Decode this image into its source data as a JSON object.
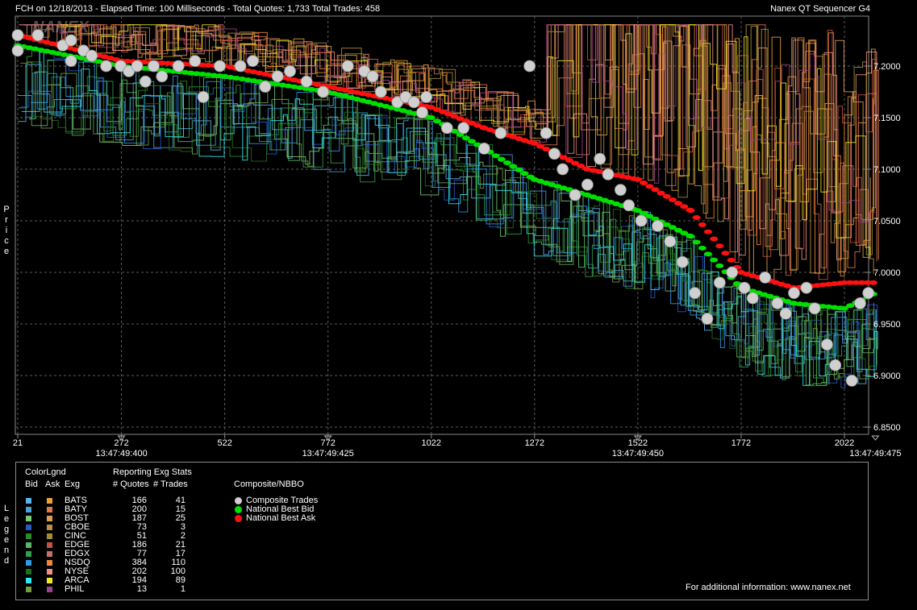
{
  "header": {
    "left": "FCH on 12/18/2013  -  Elapsed Time: 100 Milliseconds  -  Total Quotes: 1,733  Total Trades: 458",
    "right": "Nanex QT Sequencer G4",
    "watermark": "NANEX"
  },
  "y_axis_label": "Price",
  "legend_side_label": "Legend",
  "colors": {
    "background": "#000000",
    "grid": "#5a5a5a",
    "axis": "#8a8a8a",
    "trade": "#d0d0d0",
    "nbb": "#00e000",
    "nba": "#ff1010"
  },
  "chart_data": {
    "type": "scatter",
    "title": "",
    "ylim": [
      6.845,
      7.245
    ],
    "xlim": [
      21,
      2110
    ],
    "y_ticks": [
      "7.2000",
      "7.1500",
      "7.1000",
      "7.0500",
      "7.0000",
      "6.9500",
      "6.9000",
      "6.8500"
    ],
    "y_tick_values": [
      7.2,
      7.15,
      7.1,
      7.05,
      7.0,
      6.95,
      6.9,
      6.85
    ],
    "x_ticks": [
      "21",
      "272",
      "522",
      "772",
      "1022",
      "1272",
      "1522",
      "1772",
      "2022"
    ],
    "x_tick_values": [
      21,
      272,
      522,
      772,
      1022,
      1272,
      1522,
      1772,
      2022
    ],
    "time_ticks": [
      "13:47:49:400",
      "13:47:49:425",
      "13:47:49:450",
      "13:47:49:475"
    ],
    "time_tick_values": [
      272,
      772,
      1522,
      2097
    ],
    "grid": true,
    "series": [
      {
        "name": "Composite Trades",
        "marker": "circle",
        "color": "#d0d0d0",
        "points": [
          [
            21,
            7.23
          ],
          [
            21,
            7.215
          ],
          [
            70,
            7.23
          ],
          [
            130,
            7.22
          ],
          [
            150,
            7.225
          ],
          [
            150,
            7.205
          ],
          [
            180,
            7.215
          ],
          [
            200,
            7.21
          ],
          [
            235,
            7.2
          ],
          [
            270,
            7.2
          ],
          [
            290,
            7.195
          ],
          [
            310,
            7.2
          ],
          [
            330,
            7.185
          ],
          [
            350,
            7.2
          ],
          [
            370,
            7.19
          ],
          [
            410,
            7.2
          ],
          [
            450,
            7.205
          ],
          [
            470,
            7.17
          ],
          [
            510,
            7.2
          ],
          [
            560,
            7.2
          ],
          [
            590,
            7.205
          ],
          [
            620,
            7.18
          ],
          [
            650,
            7.19
          ],
          [
            680,
            7.195
          ],
          [
            720,
            7.185
          ],
          [
            760,
            7.175
          ],
          [
            820,
            7.2
          ],
          [
            860,
            7.195
          ],
          [
            880,
            7.19
          ],
          [
            900,
            7.175
          ],
          [
            940,
            7.165
          ],
          [
            960,
            7.17
          ],
          [
            980,
            7.165
          ],
          [
            1000,
            7.155
          ],
          [
            1010,
            7.17
          ],
          [
            1060,
            7.14
          ],
          [
            1100,
            7.14
          ],
          [
            1150,
            7.12
          ],
          [
            1190,
            7.135
          ],
          [
            1260,
            7.2
          ],
          [
            1300,
            7.135
          ],
          [
            1320,
            7.115
          ],
          [
            1340,
            7.1
          ],
          [
            1370,
            7.075
          ],
          [
            1400,
            7.085
          ],
          [
            1430,
            7.11
          ],
          [
            1450,
            7.095
          ],
          [
            1480,
            7.08
          ],
          [
            1500,
            7.065
          ],
          [
            1530,
            7.05
          ],
          [
            1570,
            7.045
          ],
          [
            1600,
            7.03
          ],
          [
            1630,
            7.01
          ],
          [
            1660,
            6.98
          ],
          [
            1690,
            6.955
          ],
          [
            1720,
            6.99
          ],
          [
            1750,
            7.0
          ],
          [
            1780,
            6.985
          ],
          [
            1800,
            6.975
          ],
          [
            1830,
            6.995
          ],
          [
            1860,
            6.97
          ],
          [
            1880,
            6.96
          ],
          [
            1900,
            6.98
          ],
          [
            1930,
            6.985
          ],
          [
            1950,
            6.965
          ],
          [
            1980,
            6.93
          ],
          [
            2000,
            6.91
          ],
          [
            2040,
            6.895
          ],
          [
            2060,
            6.97
          ],
          [
            2080,
            6.98
          ]
        ]
      },
      {
        "name": "National Best Bid",
        "marker": "dot",
        "color": "#00e000",
        "points": [
          [
            21,
            7.22
          ],
          [
            272,
            7.2
          ],
          [
            522,
            7.19
          ],
          [
            772,
            7.175
          ],
          [
            1022,
            7.15
          ],
          [
            1150,
            7.12
          ],
          [
            1272,
            7.09
          ],
          [
            1400,
            7.075
          ],
          [
            1522,
            7.06
          ],
          [
            1650,
            7.035
          ],
          [
            1772,
            6.985
          ],
          [
            1900,
            6.97
          ],
          [
            2022,
            6.965
          ],
          [
            2097,
            6.98
          ]
        ]
      },
      {
        "name": "National Best Ask",
        "marker": "dot",
        "color": "#ff1010",
        "points": [
          [
            21,
            7.23
          ],
          [
            272,
            7.205
          ],
          [
            522,
            7.2
          ],
          [
            772,
            7.18
          ],
          [
            1022,
            7.16
          ],
          [
            1150,
            7.14
          ],
          [
            1272,
            7.125
          ],
          [
            1400,
            7.1
          ],
          [
            1522,
            7.09
          ],
          [
            1650,
            7.06
          ],
          [
            1772,
            7.0
          ],
          [
            1900,
            6.985
          ],
          [
            2022,
            6.99
          ],
          [
            2097,
            6.99
          ]
        ]
      }
    ]
  },
  "legend": {
    "colorlgnd_title": "ColorLgnd",
    "bid_header": "Bid",
    "ask_header": "Ask",
    "exg_header": "Exg",
    "stats_title": "Reporting Exg Stats",
    "quotes_header": "# Quotes",
    "trades_header": "# Trades",
    "composite_title": "Composite/NBBO",
    "composite_items": [
      {
        "label": "Composite Trades",
        "color": "#d0d0d0"
      },
      {
        "label": "National Best Bid",
        "color": "#00e000"
      },
      {
        "label": "National Best Ask",
        "color": "#ff1010"
      }
    ],
    "exchanges": [
      {
        "name": "BATS",
        "quotes": "166",
        "trades": "41",
        "bid_color": "#5ab4f0",
        "ask_color": "#f0a030"
      },
      {
        "name": "BATY",
        "quotes": "200",
        "trades": "15",
        "bid_color": "#4aa0d8",
        "ask_color": "#e07848"
      },
      {
        "name": "BOST",
        "quotes": "187",
        "trades": "25",
        "bid_color": "#78c878",
        "ask_color": "#d8a050"
      },
      {
        "name": "CBOE",
        "quotes": "73",
        "trades": "3",
        "bid_color": "#2858c8",
        "ask_color": "#b89040"
      },
      {
        "name": "CINC",
        "quotes": "51",
        "trades": "2",
        "bid_color": "#288c28",
        "ask_color": "#a09030"
      },
      {
        "name": "EDGE",
        "quotes": "186",
        "trades": "21",
        "bid_color": "#58b868",
        "ask_color": "#c85040"
      },
      {
        "name": "EDGX",
        "quotes": "77",
        "trades": "17",
        "bid_color": "#30a048",
        "ask_color": "#c87060"
      },
      {
        "name": "NSDQ",
        "quotes": "384",
        "trades": "110",
        "bid_color": "#3098e8",
        "ask_color": "#f08838"
      },
      {
        "name": "NYSE",
        "quotes": "202",
        "trades": "100",
        "bid_color": "#1e6e1e",
        "ask_color": "#f09088"
      },
      {
        "name": "ARCA",
        "quotes": "194",
        "trades": "89",
        "bid_color": "#30e8f0",
        "ask_color": "#f0e820"
      },
      {
        "name": "PHIL",
        "quotes": "13",
        "trades": "1",
        "bid_color": "#70a040",
        "ask_color": "#a0408c"
      }
    ],
    "footer": "For additional information: www.nanex.net"
  }
}
